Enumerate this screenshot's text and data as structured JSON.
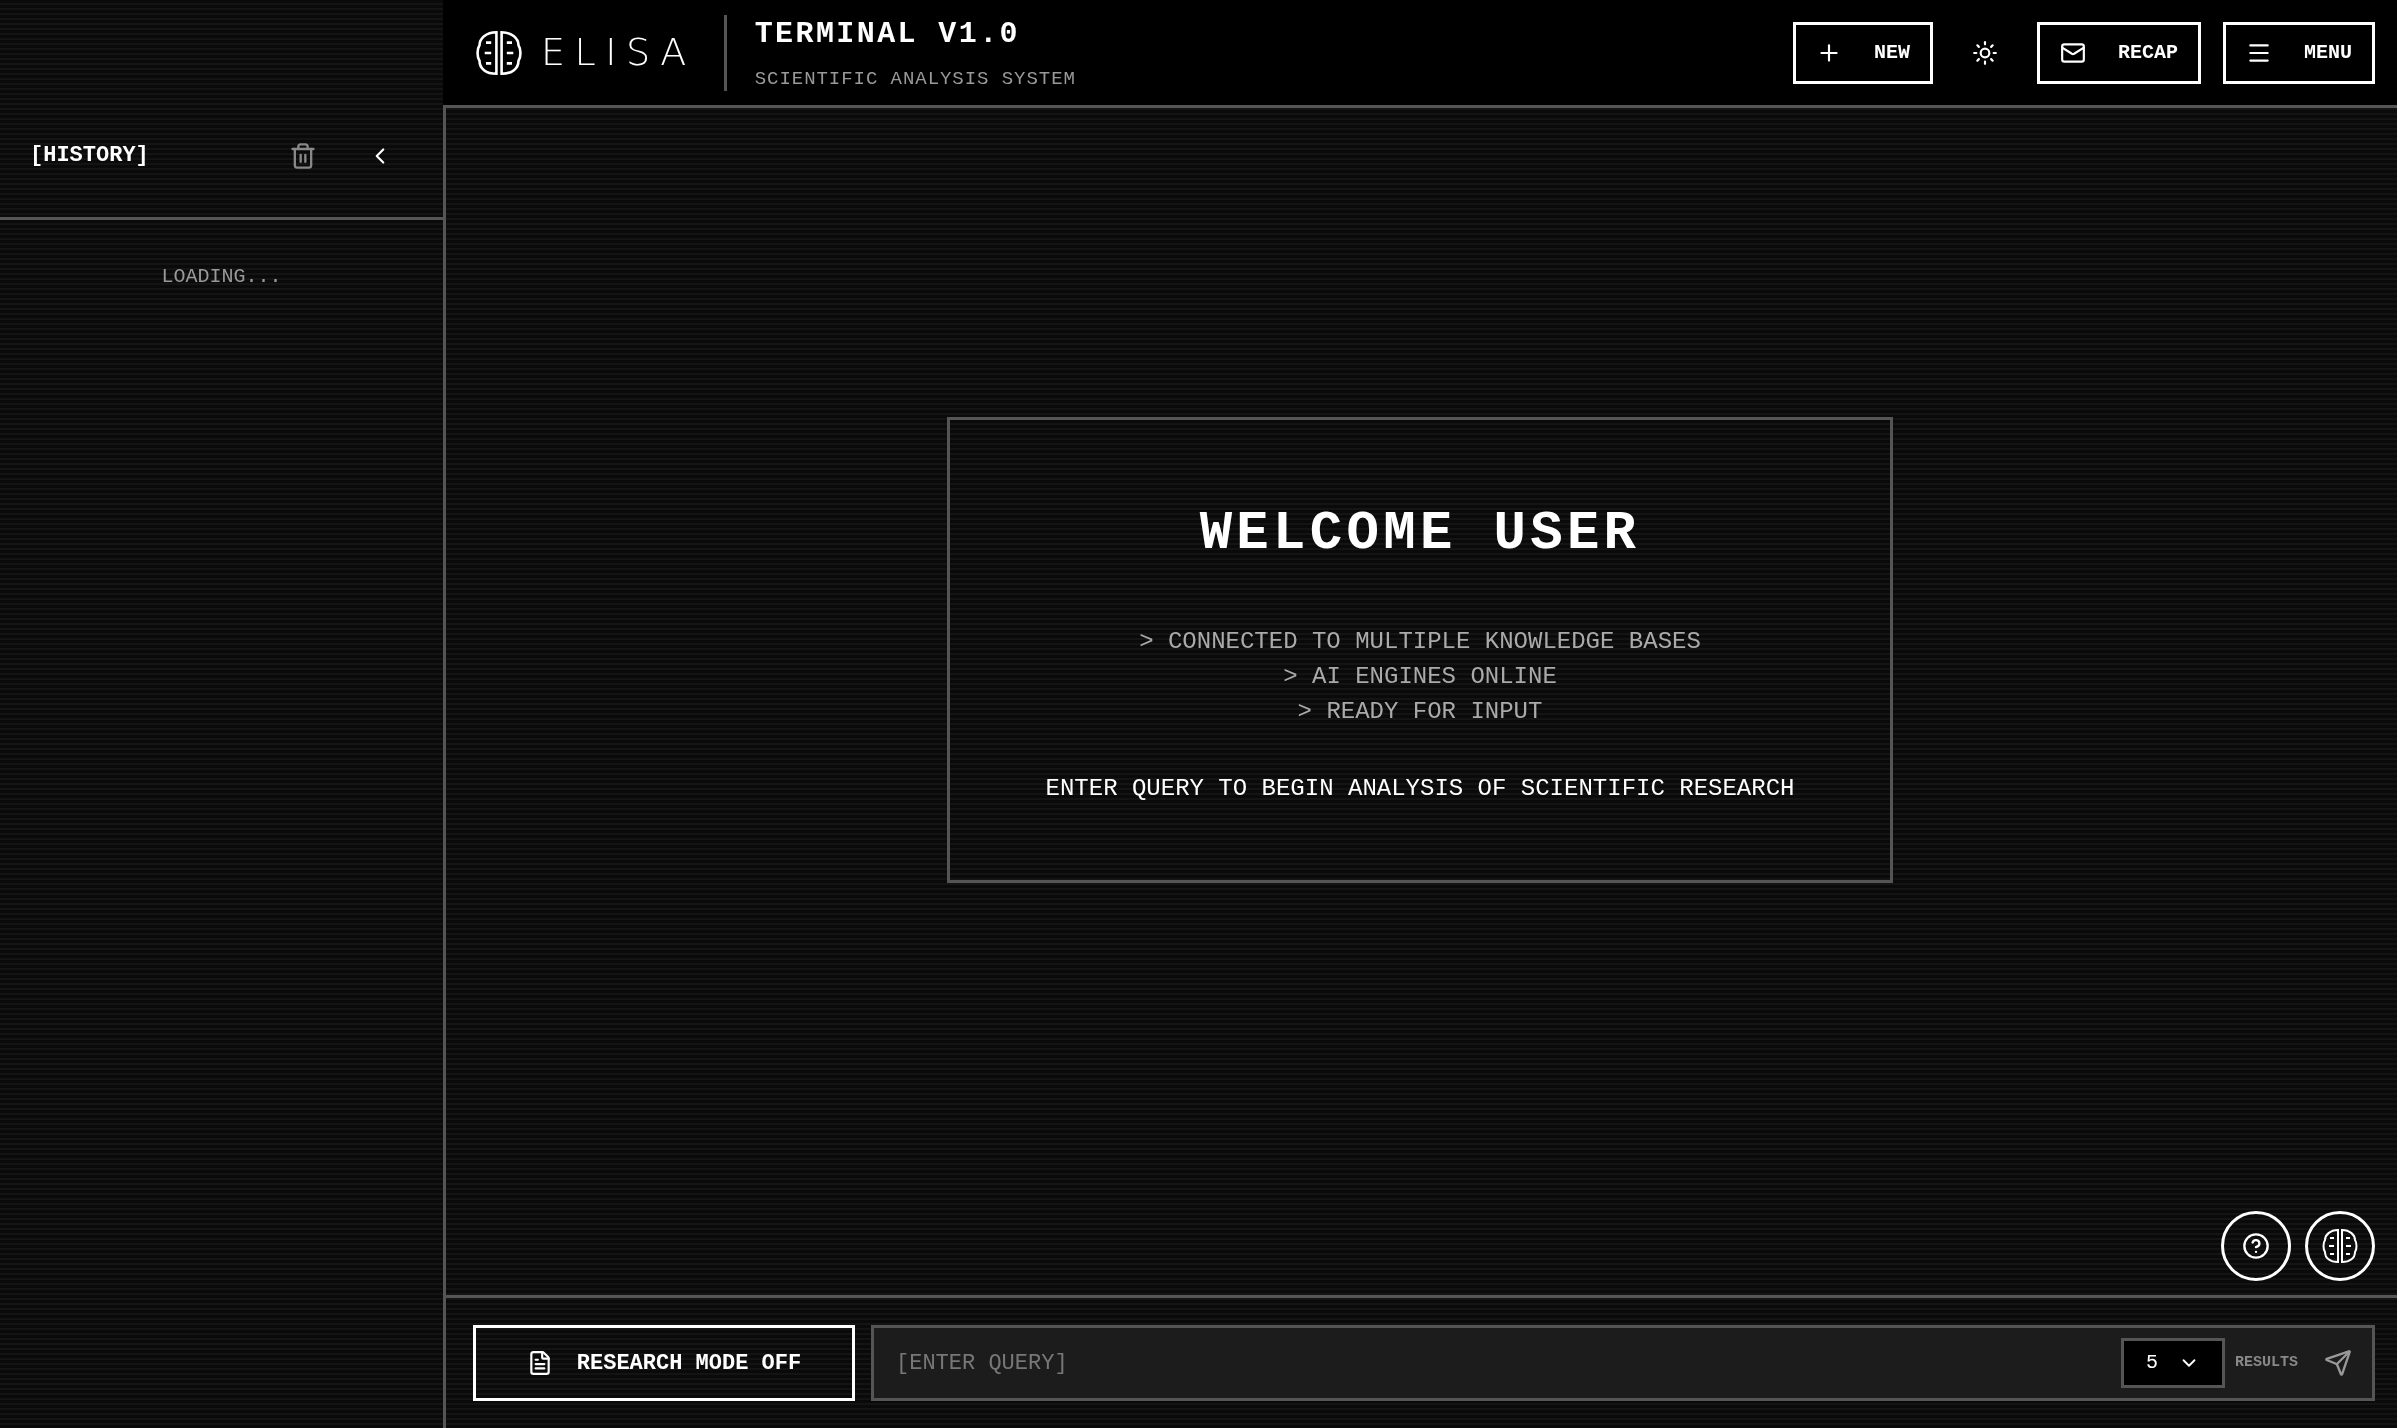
{
  "header": {
    "logo_text": "ELISA",
    "title": "TERMINAL V1.0",
    "subtitle": "SCIENTIFIC ANALYSIS SYSTEM",
    "buttons": [
      {
        "kind": "new",
        "label": "NEW"
      },
      {
        "kind": "theme"
      },
      {
        "kind": "recap",
        "label": "RECAP"
      },
      {
        "kind": "menu",
        "label": "MENU"
      }
    ]
  },
  "sidebar": {
    "title": "[HISTORY]",
    "status": "LOADING..."
  },
  "welcome": {
    "title": "WELCOME USER",
    "lines": [
      "> CONNECTED TO MULTIPLE KNOWLEDGE BASES",
      "> AI ENGINES ONLINE",
      "> READY FOR INPUT"
    ],
    "prompt": "ENTER QUERY TO BEGIN ANALYSIS OF SCIENTIFIC RESEARCH"
  },
  "composer": {
    "research_mode": {
      "label": "RESEARCH MODE OFF",
      "on": false
    },
    "query": {
      "placeholder": "[ENTER QUERY]"
    },
    "results": {
      "value": "5",
      "label": "RESULTS"
    }
  }
}
